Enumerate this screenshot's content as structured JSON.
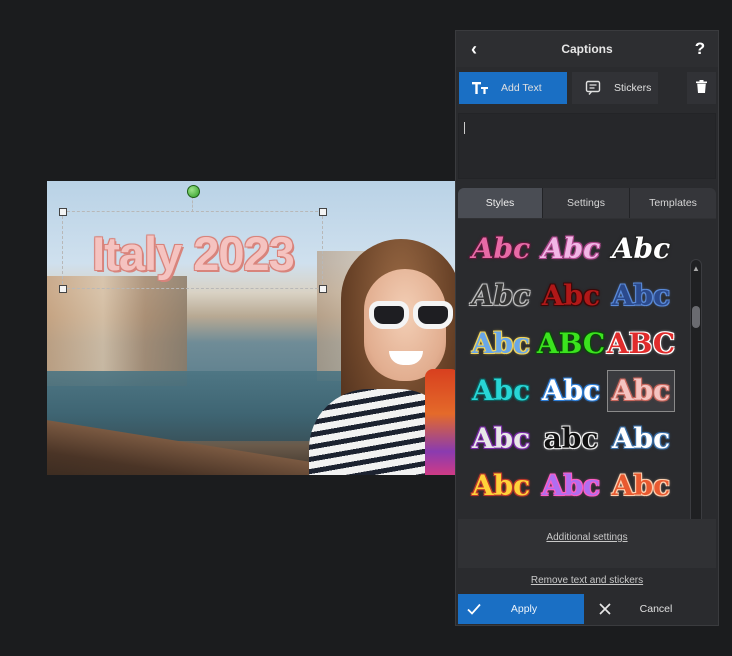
{
  "canvas": {
    "caption_text": "Italy 2023",
    "caption_color": "#f5c3c0",
    "caption_outline_color": "#d8847c"
  },
  "panel": {
    "title": "Captions",
    "back_icon": "chevron-left-icon",
    "help_icon": "?",
    "toolbar": {
      "add_text_label": "Add Text",
      "stickers_label": "Stickers",
      "add_text_icon": "text-icon",
      "stickers_icon": "sticker-icon",
      "trash_icon": "trash-icon"
    },
    "tabs": [
      {
        "label": "Styles",
        "active": true
      },
      {
        "label": "Settings",
        "active": false
      },
      {
        "label": "Templates",
        "active": false
      }
    ],
    "styles": [
      {
        "text": "Abc",
        "color": "#e86aa6",
        "outline": "#5a1a3a",
        "italic": true
      },
      {
        "text": "Abc",
        "color": "#f2b6e6",
        "outline": "#b0498f",
        "italic": true
      },
      {
        "text": "Abc",
        "color": "#ffffff",
        "outline": "#222222",
        "italic": true
      },
      {
        "text": "Abc",
        "color": "#333333",
        "outline": "#bdbdbd",
        "italic": true
      },
      {
        "text": "Abc",
        "color": "#b01818",
        "outline": "#3a0808",
        "italic": false
      },
      {
        "text": "Abc",
        "color": "#2b4a8c",
        "outline": "#5a8ad8",
        "italic": false
      },
      {
        "text": "Abc",
        "color": "#6aa7e8",
        "outline": "#f3d55b",
        "italic": false
      },
      {
        "text": "ABC",
        "color": "#3be31e",
        "outline": "#0a4a08",
        "italic": false
      },
      {
        "text": "ABC",
        "color": "#e02c2c",
        "outline": "#ffffff",
        "italic": false
      },
      {
        "text": "Abc",
        "color": "#28d6d6",
        "outline": "#0e5a5a",
        "italic": false
      },
      {
        "text": "Abc",
        "color": "#ffffff",
        "outline": "#2f7fd8",
        "italic": false
      },
      {
        "text": "Abc",
        "color": "#f5c3c0",
        "outline": "#c8665c",
        "italic": false
      },
      {
        "text": "Abc",
        "color": "#e8e8e8",
        "outline": "#7a2aa8",
        "italic": false
      },
      {
        "text": "abc",
        "color": "#111111",
        "outline": "#f0f0f0",
        "italic": false
      },
      {
        "text": "Abc",
        "color": "#ffffff",
        "outline": "#3a6fa8",
        "italic": false
      },
      {
        "text": "Abc",
        "color": "#ffd23a",
        "outline": "#c0392b",
        "italic": false
      },
      {
        "text": "Abc",
        "color": "#b06ef0",
        "outline": "#ff5ec4",
        "italic": false
      },
      {
        "text": "Abc",
        "color": "#e85a30",
        "outline": "#ffd0b0",
        "italic": false
      }
    ],
    "selected_style_index": 11,
    "additional_settings_label": "Additional settings",
    "remove_label": "Remove text and stickers",
    "apply_label": "Apply",
    "cancel_label": "Cancel",
    "accent_color": "#1a6fc4"
  }
}
